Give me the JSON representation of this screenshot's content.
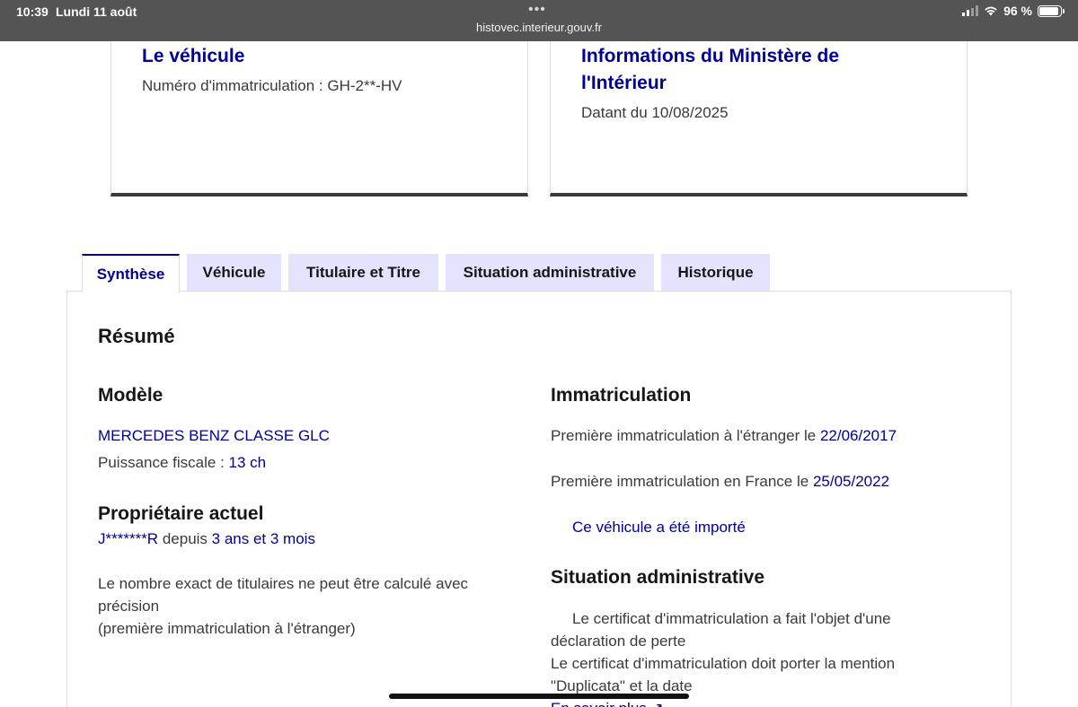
{
  "status_bar": {
    "time": "10:39",
    "date": "Lundi 11 août",
    "dots": "•••",
    "battery": "96 %",
    "url": "histovec.interieur.gouv.fr"
  },
  "card_vehicle": {
    "title": "Le véhicule",
    "plate_label": "Numéro d'immatriculation :",
    "plate_value": "GH-2**-HV"
  },
  "card_ministry": {
    "title": "Informations du Ministère de l'Intérieur",
    "date_label": "Datant du",
    "date_value": "10/08/2025"
  },
  "tabs": [
    {
      "label": "Synthèse",
      "active": true
    },
    {
      "label": "Véhicule",
      "active": false
    },
    {
      "label": "Titulaire et Titre",
      "active": false
    },
    {
      "label": "Situation administrative",
      "active": false
    },
    {
      "label": "Historique",
      "active": false
    }
  ],
  "summary": {
    "heading": "Résumé",
    "model": {
      "heading": "Modèle",
      "name": "MERCEDES BENZ CLASSE GLC",
      "power_label": "Puissance fiscale :",
      "power_value": "13 ch"
    },
    "owner": {
      "heading": "Propriétaire actuel",
      "name": "J*******R",
      "since_label": "depuis",
      "since_value": "3 ans et 3 mois",
      "note_line1": "Le nombre exact de titulaires ne peut être calculé avec",
      "note_line2": "précision",
      "note_line3": "(première immatriculation à l'étranger)"
    },
    "registration": {
      "heading": "Immatriculation",
      "foreign_label": "Première immatriculation à l'étranger le",
      "foreign_date": "22/06/2017",
      "france_label": "Première immatriculation en France le",
      "france_date": "25/05/2022",
      "imported": "Ce véhicule a été importé"
    },
    "admin": {
      "heading": "Situation administrative",
      "line1": "Le certificat d'immatriculation a fait l'objet d'une",
      "line2": "déclaration de perte",
      "line3": "Le certificat d'immatriculation doit porter la mention",
      "line4": "\"Duplicata\" et la date",
      "more": "En savoir plus"
    }
  }
}
